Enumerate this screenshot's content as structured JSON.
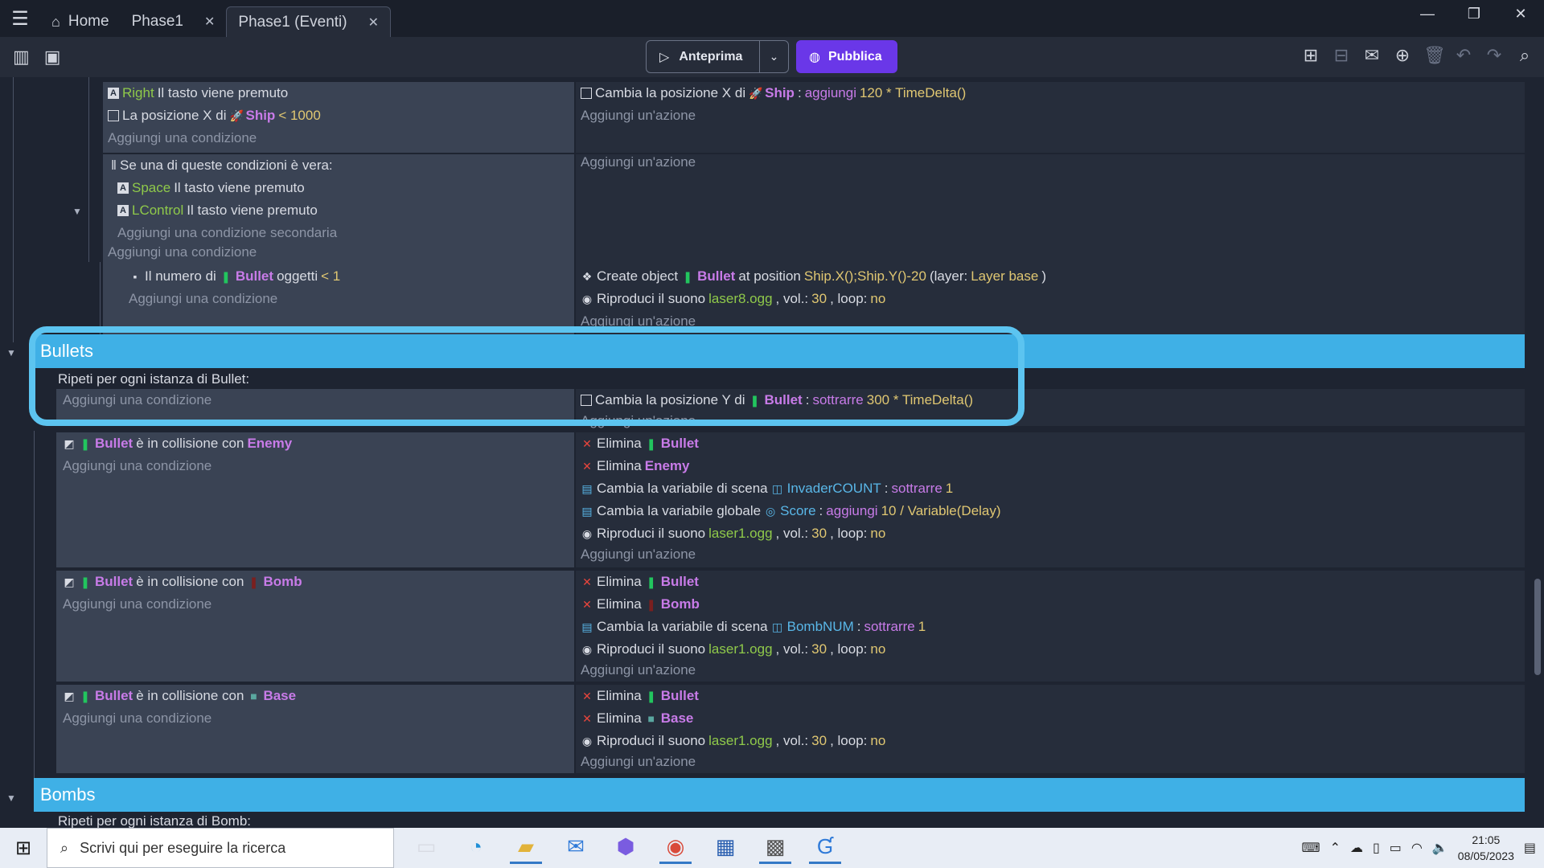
{
  "titlebar": {
    "tabs": [
      {
        "label": "Home"
      },
      {
        "label": "Phase1"
      },
      {
        "label": "Phase1 (Eventi)"
      }
    ]
  },
  "toolbar": {
    "preview_label": "Anteprima",
    "publish_label": "Pubblica"
  },
  "events": {
    "block1": {
      "conditions": [
        {
          "key": "Right",
          "text": "Il tasto viene premuto"
        },
        {
          "prefix": "La posizione X di",
          "object": "Ship",
          "op": "< 1000"
        }
      ],
      "add_condition": "Aggiungi una condizione",
      "actions": [
        {
          "prefix": "Cambia la posizione X di",
          "object": "Ship",
          "sep": ":",
          "verb": "aggiungi",
          "value": "120 * TimeDelta()"
        }
      ],
      "add_action": "Aggiungi un'azione"
    },
    "block2": {
      "or_header": "Se una di queste condizioni è vera:",
      "sub_conditions": [
        {
          "key": "Space",
          "text": "Il tasto viene premuto"
        },
        {
          "key": "LControl",
          "text": "Il tasto viene premuto"
        }
      ],
      "add_sub_condition": "Aggiungi una condizione secondaria",
      "add_condition": "Aggiungi una condizione",
      "add_action": "Aggiungi un'azione"
    },
    "block3": {
      "condition": {
        "prefix": "Il numero di",
        "object": "Bullet",
        "suffix": "oggetti",
        "op": "< 1"
      },
      "add_condition": "Aggiungi una condizione",
      "actions": [
        {
          "prefix": "Create object",
          "object": "Bullet",
          "mid": "at position",
          "pos": "Ship.X();Ship.Y()-20",
          "layer_prefix": "(layer:",
          "layer": "Layer base",
          "layer_suffix": ")"
        },
        {
          "prefix": "Riproduci il suono",
          "file": "laser8.ogg",
          "vol_label": ", vol.:",
          "vol": "30",
          "loop_label": ", loop:",
          "loop": "no"
        }
      ],
      "add_action": "Aggiungi un'azione"
    },
    "groups": {
      "bullets": {
        "title": "Bullets"
      },
      "bombs": {
        "title": "Bombs"
      }
    },
    "bullets_foreach": {
      "header": "Ripeti per ogni istanza di Bullet:",
      "add_condition": "Aggiungi una condizione",
      "action": {
        "prefix": "Cambia la posizione Y di",
        "object": "Bullet",
        "sep": ":",
        "verb": "sottrarre",
        "value": "300 * TimeDelta()"
      },
      "add_action": "Aggiungi un'azione"
    },
    "collision_enemy": {
      "condition": {
        "object": "Bullet",
        "mid": "è in collisione con",
        "target": "Enemy"
      },
      "add_condition": "Aggiungi una condizione",
      "actions": {
        "delete1": {
          "prefix": "Elimina",
          "object": "Bullet"
        },
        "delete2": {
          "prefix": "Elimina",
          "object": "Enemy"
        },
        "scene_var": {
          "prefix": "Cambia la variabile di scena",
          "var": "InvaderCOUNT",
          "sep": ":",
          "verb": "sottrarre",
          "value": "1"
        },
        "global_var": {
          "prefix": "Cambia la variabile globale",
          "var": "Score",
          "sep": ":",
          "verb": "aggiungi",
          "value": "10 / Variable(Delay)"
        },
        "sound": {
          "prefix": "Riproduci il suono",
          "file": "laser1.ogg",
          "vol_label": ", vol.:",
          "vol": "30",
          "loop_label": ", loop:",
          "loop": "no"
        }
      },
      "add_action": "Aggiungi un'azione"
    },
    "collision_bomb": {
      "condition": {
        "object": "Bullet",
        "mid": "è in collisione con",
        "target": "Bomb"
      },
      "add_condition": "Aggiungi una condizione",
      "actions": {
        "delete1": {
          "prefix": "Elimina",
          "object": "Bullet"
        },
        "delete2": {
          "prefix": "Elimina",
          "object": "Bomb"
        },
        "scene_var": {
          "prefix": "Cambia la variabile di scena",
          "var": "BombNUM",
          "sep": ":",
          "verb": "sottrarre",
          "value": "1"
        },
        "sound": {
          "prefix": "Riproduci il suono",
          "file": "laser1.ogg",
          "vol_label": ", vol.:",
          "vol": "30",
          "loop_label": ", loop:",
          "loop": "no"
        }
      },
      "add_action": "Aggiungi un'azione"
    },
    "collision_base": {
      "condition": {
        "object": "Bullet",
        "mid": "è in collisione con",
        "target": "Base"
      },
      "add_condition": "Aggiungi una condizione",
      "actions": {
        "delete1": {
          "prefix": "Elimina",
          "object": "Bullet"
        },
        "delete2": {
          "prefix": "Elimina",
          "object": "Base"
        },
        "sound": {
          "prefix": "Riproduci il suono",
          "file": "laser1.ogg",
          "vol_label": ", vol.:",
          "vol": "30",
          "loop_label": ", loop:",
          "loop": "no"
        }
      },
      "add_action": "Aggiungi un'azione"
    },
    "bombs_foreach": {
      "header": "Ripeti per ogni istanza di Bomb:"
    }
  },
  "taskbar": {
    "search_placeholder": "Scrivi qui per eseguire la ricerca",
    "time": "21:05",
    "date": "08/05/2023"
  },
  "colors": {
    "group_bar": "#3fb0e6",
    "publish": "#6a37e8",
    "highlight": "#5cc4f0"
  }
}
